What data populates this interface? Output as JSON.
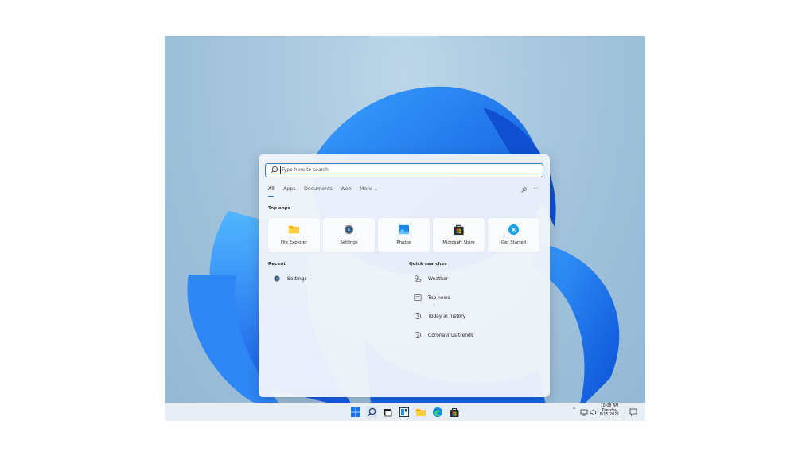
{
  "search": {
    "placeholder": "Type here to search"
  },
  "tabs": [
    {
      "label": "All",
      "active": true
    },
    {
      "label": "Apps"
    },
    {
      "label": "Documents"
    },
    {
      "label": "Web"
    },
    {
      "label": "More ⌄"
    }
  ],
  "tools": {
    "more_label": "···"
  },
  "top_apps": {
    "title": "Top apps",
    "items": [
      {
        "label": "File Explorer",
        "icon": "folder-icon"
      },
      {
        "label": "Settings",
        "icon": "gear-icon"
      },
      {
        "label": "Photos",
        "icon": "photos-icon"
      },
      {
        "label": "Microsoft Store",
        "icon": "store-icon"
      },
      {
        "label": "Get Started",
        "icon": "get-started-icon"
      }
    ]
  },
  "recent": {
    "title": "Recent",
    "items": [
      {
        "label": "Settings",
        "icon": "gear-icon"
      }
    ]
  },
  "quick_searches": {
    "title": "Quick searches",
    "items": [
      {
        "label": "Weather",
        "icon": "weather-icon"
      },
      {
        "label": "Top news",
        "icon": "news-icon"
      },
      {
        "label": "Today in history",
        "icon": "clock-icon"
      },
      {
        "label": "Coronavirus trends",
        "icon": "info-icon"
      }
    ]
  },
  "taskbar": {
    "apps": [
      "start-icon",
      "search-icon",
      "task-view-icon",
      "widgets-icon",
      "file-explorer-icon",
      "edge-icon",
      "store-icon"
    ],
    "clock": {
      "time": "10:08 AM",
      "day": "Tuesday",
      "date": "6/15/2021"
    },
    "tray_chevron": "^"
  },
  "colors": {
    "accent": "#1a73c9",
    "bloom": "#1e6ff0"
  }
}
